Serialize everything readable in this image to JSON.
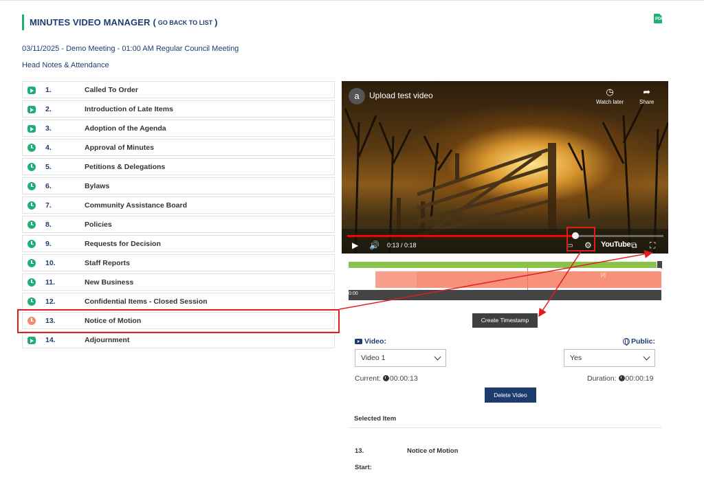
{
  "header": {
    "title": "MINUTES VIDEO MANAGER",
    "paren_open": "(",
    "back_link": "GO BACK TO LIST",
    "paren_close": ")",
    "pdf_icon": "pdf-icon",
    "pdf_glyph": "PDF"
  },
  "meeting_info": "03/11/2025 - Demo Meeting - 01:00 AM Regular Council Meeting",
  "head_notes_link": "Head Notes & Attendance",
  "agenda": {
    "items": [
      {
        "icon": "play",
        "num": "1.",
        "label": "Called To Order"
      },
      {
        "icon": "play",
        "num": "2.",
        "label": "Introduction of Late Items"
      },
      {
        "icon": "play",
        "num": "3.",
        "label": "Adoption of the Agenda"
      },
      {
        "icon": "clock",
        "num": "4.",
        "label": "Approval of Minutes"
      },
      {
        "icon": "clock",
        "num": "5.",
        "label": "Petitions & Delegations"
      },
      {
        "icon": "clock",
        "num": "6.",
        "label": "Bylaws"
      },
      {
        "icon": "clock",
        "num": "7.",
        "label": "Community Assistance Board"
      },
      {
        "icon": "clock",
        "num": "8.",
        "label": "Policies"
      },
      {
        "icon": "clock",
        "num": "9.",
        "label": "Requests for Decision"
      },
      {
        "icon": "clock",
        "num": "10.",
        "label": "Staff Reports"
      },
      {
        "icon": "clock",
        "num": "11.",
        "label": "New Business"
      },
      {
        "icon": "clock",
        "num": "12.",
        "label": "Confidential Items - Closed Session"
      },
      {
        "icon": "clock-orange",
        "num": "13.",
        "label": "Notice of Motion",
        "selected": true
      },
      {
        "icon": "play",
        "num": "14.",
        "label": "Adjournment"
      }
    ]
  },
  "video_player": {
    "channel_initial": "a",
    "title": "Upload test video",
    "watch_later": "Watch later",
    "share": "Share",
    "time": "0:13 / 0:18",
    "progress": 0.722,
    "youtube": "YouTube"
  },
  "timeline": {
    "start_label": "0:00",
    "segment_label": "[2]"
  },
  "create_timestamp_label": "Create Timestamp",
  "video_select": {
    "label": "Video:",
    "value": "Video 1"
  },
  "public_select": {
    "label": "Public:",
    "value": "Yes"
  },
  "current": {
    "label": "Current:",
    "value": "00:00:13"
  },
  "duration": {
    "label": "Duration:",
    "value": "00:00:19"
  },
  "delete_video_label": "Delete Video",
  "selected_item": {
    "header": "Selected Item",
    "num": "13.",
    "name": "Notice of Motion",
    "start_label": "Start:"
  },
  "colors": {
    "brand_navy": "#1d3c6e",
    "accent_green": "#1fae73",
    "highlight_orange": "#f08a6a",
    "annotation_red": "#e21c1c"
  }
}
